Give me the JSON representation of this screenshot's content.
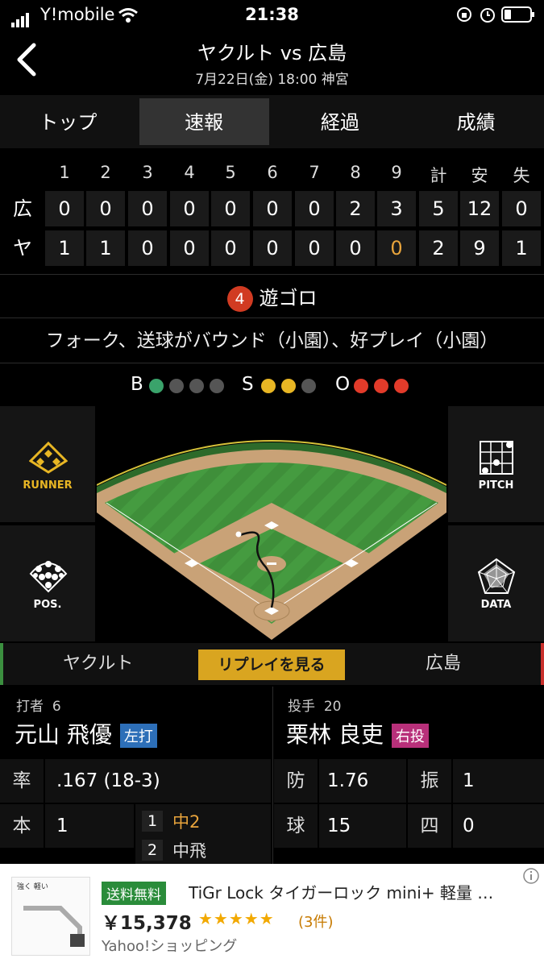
{
  "status_bar": {
    "carrier": "Y!mobile",
    "time": "21:38"
  },
  "header": {
    "title": "ヤクルト vs 広島",
    "subtitle": "7月22日(金) 18:00 神宮"
  },
  "tabs": [
    "トップ",
    "速報",
    "経過",
    "成績"
  ],
  "scoreboard": {
    "headers": [
      "1",
      "2",
      "3",
      "4",
      "5",
      "6",
      "7",
      "8",
      "9",
      "計",
      "安",
      "失"
    ],
    "rows": [
      {
        "team": "広",
        "values": [
          "0",
          "0",
          "0",
          "0",
          "0",
          "0",
          "0",
          "2",
          "3",
          "5",
          "12",
          "0"
        ]
      },
      {
        "team": "ヤ",
        "values": [
          "1",
          "1",
          "0",
          "0",
          "0",
          "0",
          "0",
          "0",
          "0",
          "2",
          "9",
          "1"
        ]
      }
    ]
  },
  "play": {
    "number": "4",
    "result": "遊ゴロ",
    "description": "フォーク、送球がバウンド（小園）、好プレイ（小園）"
  },
  "count": {
    "b_label": "B",
    "s_label": "S",
    "o_label": "O",
    "balls": 1,
    "strikes": 2,
    "outs": 3,
    "colors": {
      "ball": "#3aa36b",
      "strike": "#e8b624",
      "out": "#e23b2a",
      "off": "#555555"
    }
  },
  "side_buttons": {
    "runner": "RUNNER",
    "pitch": "PITCH",
    "pos": "POS.",
    "data": "DATA"
  },
  "team_bar": {
    "left": "ヤクルト",
    "replay": "リプレイを見る",
    "right": "広島"
  },
  "batter": {
    "label": "打者",
    "number": "6",
    "name": "元山 飛優",
    "badge": "左打"
  },
  "pitcher": {
    "label": "投手",
    "number": "20",
    "name": "栗林 良吏",
    "badge": "右投"
  },
  "batter_stats": {
    "avg_key": "率",
    "avg_val": ".167 (18-3)",
    "hr_key": "本",
    "hr_val": "1",
    "history": [
      {
        "no": "1",
        "result": "中2"
      },
      {
        "no": "2",
        "result": "中飛"
      }
    ]
  },
  "pitcher_stats": {
    "era_key": "防",
    "era_val": "1.76",
    "k_key": "振",
    "k_val": "1",
    "pitches_key": "球",
    "pitches_val": "15",
    "bb_key": "四",
    "bb_val": "0"
  },
  "ad": {
    "tag": "送料無料",
    "name": "TiGr Lock タイガーロック mini+ 軽量 …",
    "price": "￥15,378",
    "stars": "★★★★★",
    "reviews": "(3件)",
    "source": "Yahoo!ショッピング",
    "img_caption": "強く 軽い"
  }
}
